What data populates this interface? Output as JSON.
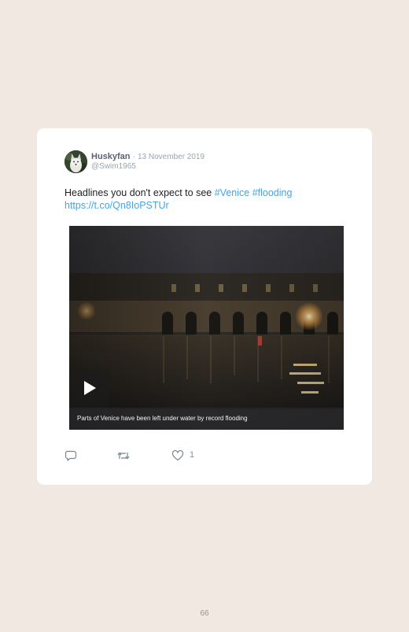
{
  "tweet": {
    "user": {
      "display_name": "Huskyfan",
      "handle": "@Swim1965",
      "avatar_icon": "husky-dog-avatar"
    },
    "separator": "·",
    "date": "13 November 2019",
    "text": "Headlines you don't expect to see",
    "hashtags": [
      "#Venice",
      "#flooding"
    ],
    "link": "https://t.co/Qn8IoPSTUr",
    "media": {
      "type": "video",
      "caption": "Parts of Venice have been left under water by record flooding",
      "play_icon": "play-icon"
    },
    "actions": {
      "reply_icon": "reply-icon",
      "retweet_icon": "retweet-icon",
      "like_icon": "heart-icon",
      "like_count": "1"
    }
  },
  "colors": {
    "page_background": "#f1e9e1",
    "card_background": "#ffffff",
    "link": "#4aa3df",
    "text": "#1d2126",
    "muted": "#9aa3ad"
  },
  "page_number": "66"
}
